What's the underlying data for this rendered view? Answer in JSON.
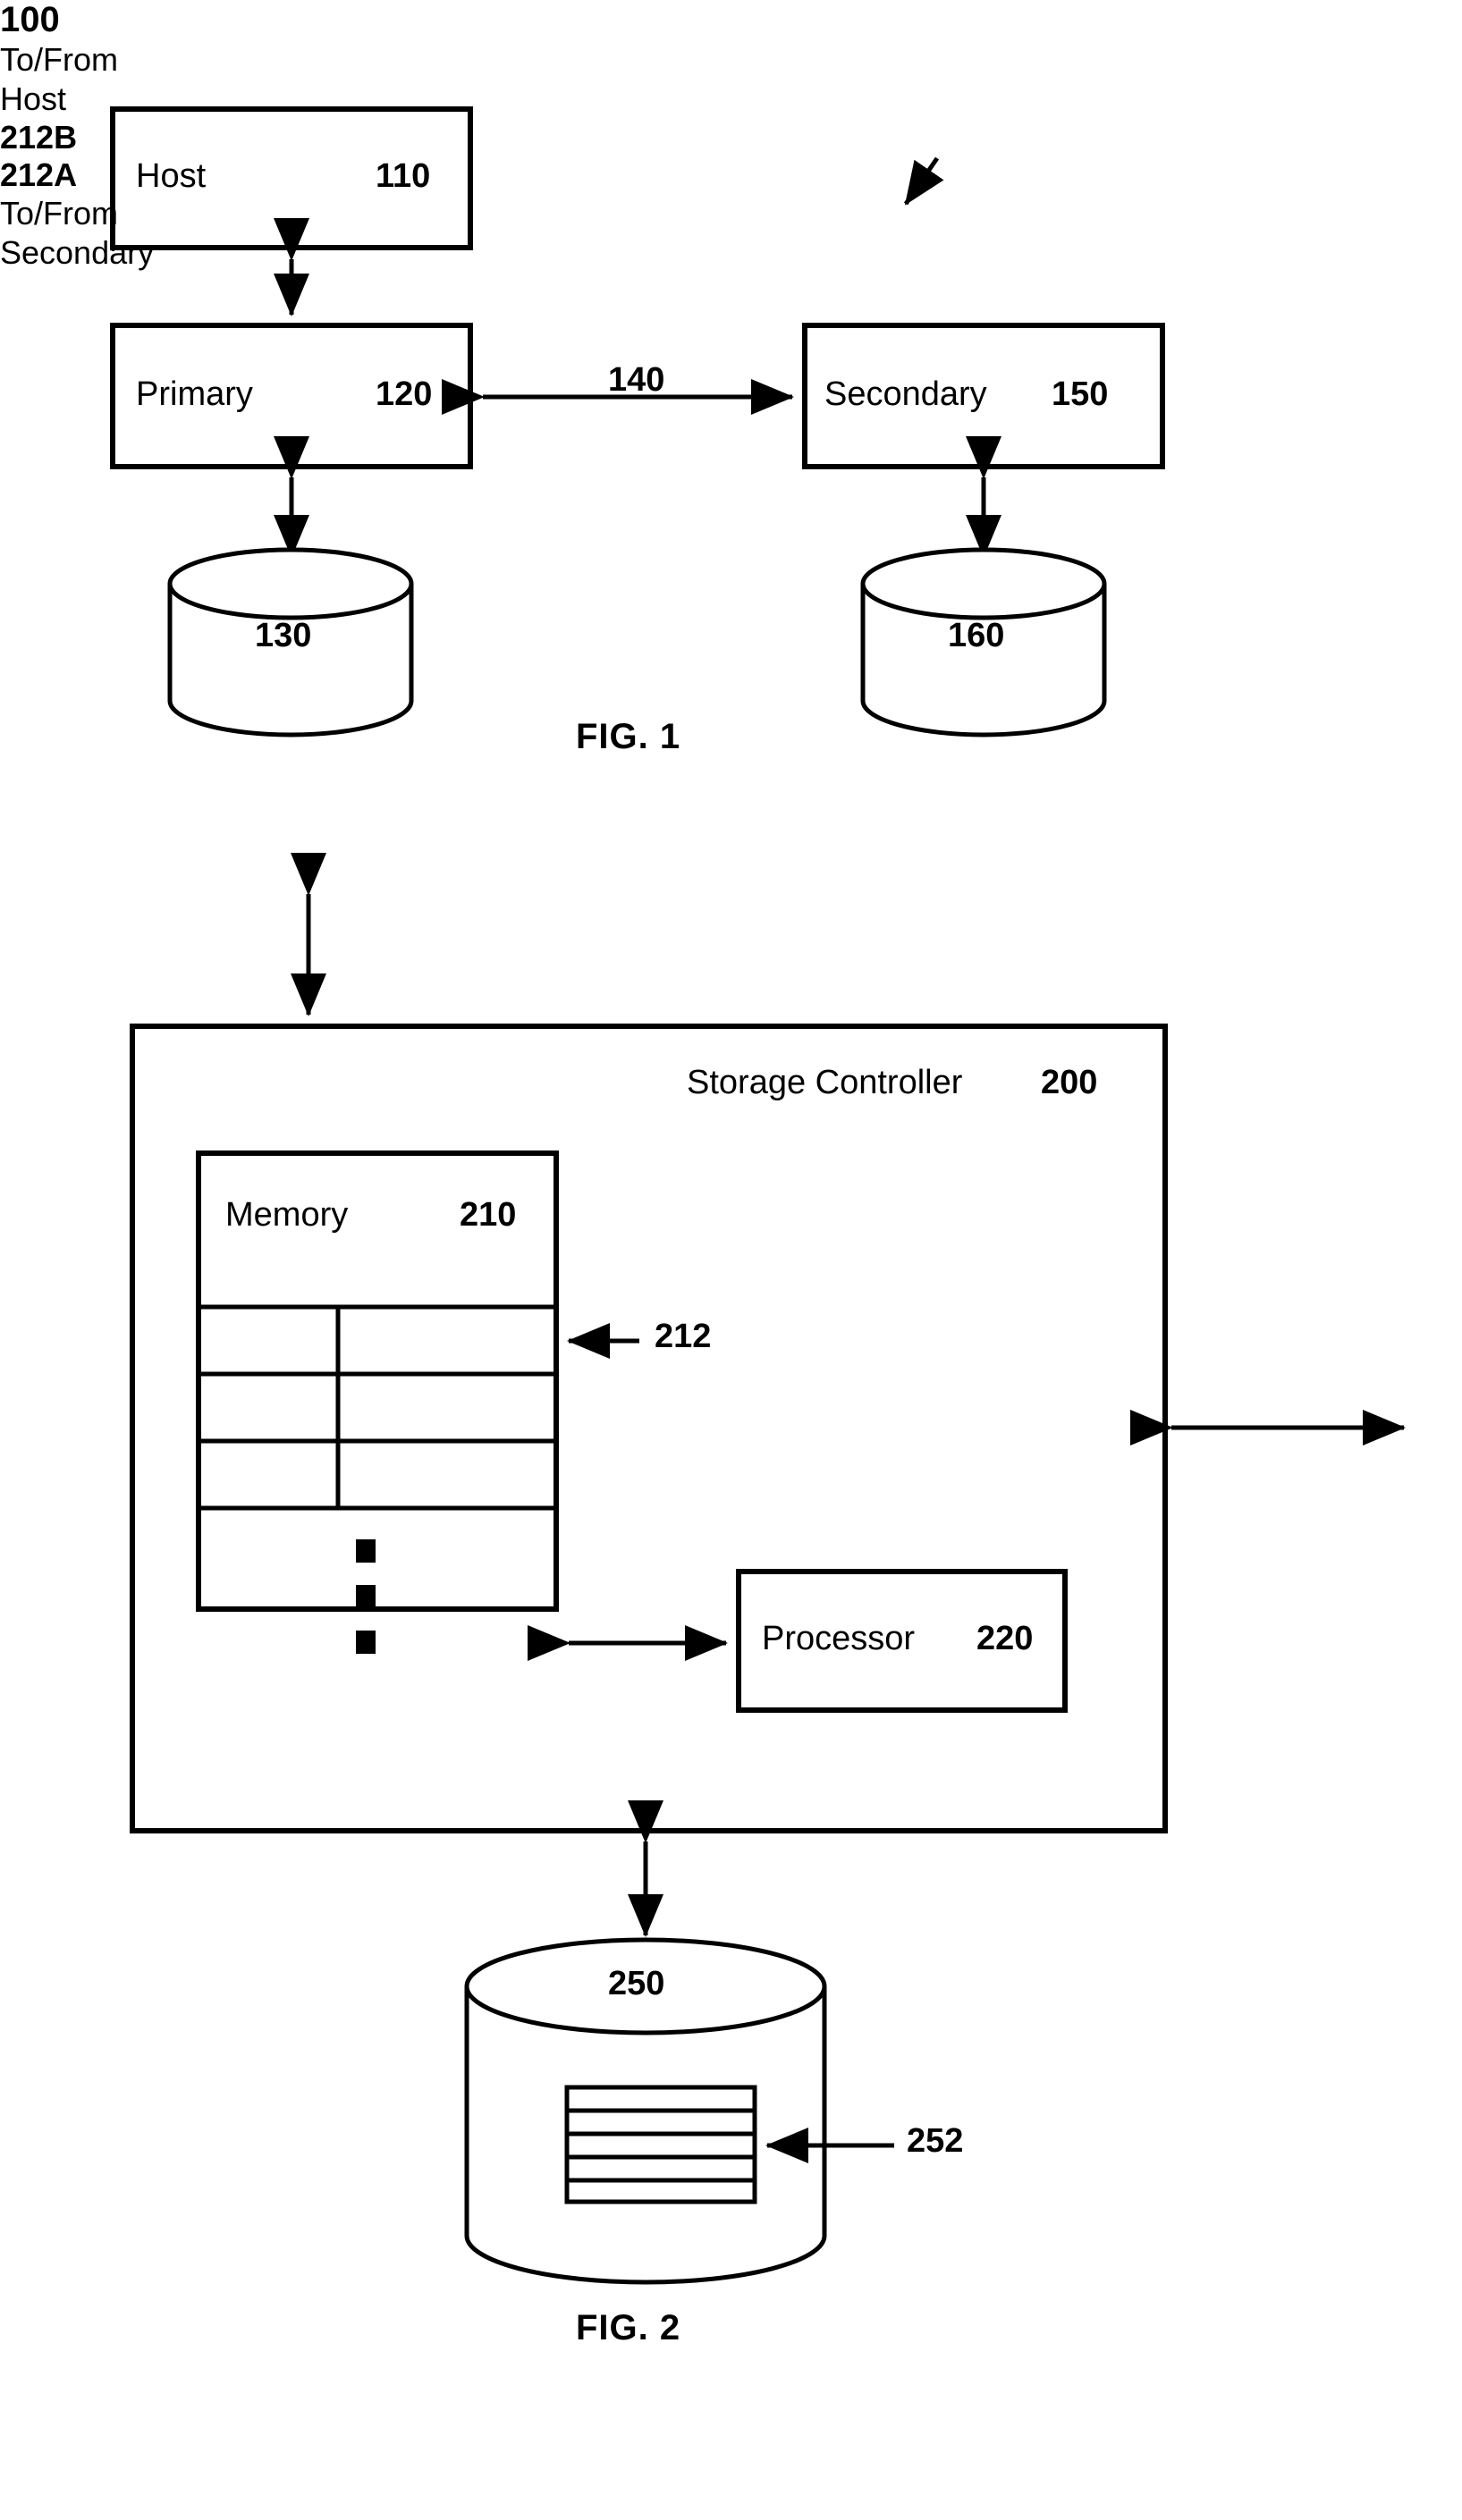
{
  "document": {
    "type": "patent-figure-sheet",
    "figures": [
      "FIG. 1",
      "FIG. 2"
    ]
  },
  "fig1": {
    "caption": "FIG. 1",
    "system_ref": "100",
    "boxes": [
      {
        "id": "host",
        "label": "Host",
        "ref": "110"
      },
      {
        "id": "primary",
        "label": "Primary",
        "ref": "120"
      },
      {
        "id": "secondary",
        "label": "Secondary",
        "ref": "150"
      }
    ],
    "cylinders": [
      {
        "id": "primary-storage",
        "ref": "130"
      },
      {
        "id": "secondary-storage",
        "ref": "160"
      }
    ],
    "links": [
      {
        "id": "host-primary",
        "ref": "",
        "style": "double-arrow-vertical"
      },
      {
        "id": "primary-storage-link",
        "ref": "",
        "style": "double-arrow-vertical"
      },
      {
        "id": "primary-secondary",
        "ref": "140",
        "style": "double-arrow-horizontal"
      },
      {
        "id": "secondary-storage-link",
        "ref": "",
        "style": "double-arrow-vertical"
      }
    ]
  },
  "fig2": {
    "caption": "FIG. 2",
    "controller": {
      "label": "Storage Controller",
      "ref": "200"
    },
    "memory": {
      "label": "Memory",
      "ref": "210"
    },
    "processor": {
      "label": "Processor",
      "ref": "220"
    },
    "table": {
      "ref": "212",
      "header": [
        "212B",
        "212A"
      ],
      "empty_rows": 3,
      "ellipsis_row": "vertical-ellipsis"
    },
    "io_top": {
      "lines": [
        "To/From",
        "Host"
      ]
    },
    "io_right": {
      "lines": [
        "To/From",
        "Secondary"
      ]
    },
    "storage": {
      "ref": "250"
    },
    "storage_detail": {
      "ref": "252",
      "stripe_count": 5
    }
  },
  "colors": {
    "ink": "#000000",
    "paper": "#ffffff"
  }
}
